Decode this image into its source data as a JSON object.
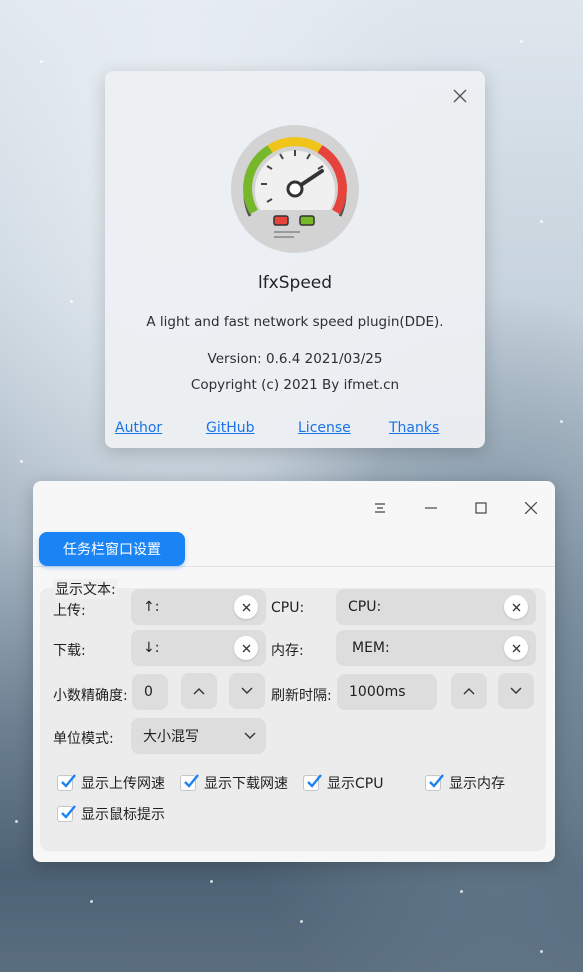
{
  "about": {
    "app_name": "lfxSpeed",
    "description": "A light and fast network speed plugin(DDE).",
    "version": "Version: 0.6.4  2021/03/25",
    "copyright": "Copyright (c) 2021 By ifmet.cn",
    "links": [
      "Author",
      "GitHub",
      "License",
      "Thanks"
    ]
  },
  "settings": {
    "tab": "任务栏窗口设置",
    "section_title": "显示文本:",
    "upload_label": "上传:",
    "upload_value": "↑:",
    "download_label": "下载:",
    "download_value": "↓:",
    "cpu_label": "CPU:",
    "cpu_value": "CPU:",
    "mem_label": "内存:",
    "mem_value": "MEM:",
    "precision_label": "小数精确度:",
    "precision_value": "0",
    "refresh_label": "刷新时隔:",
    "refresh_value": "1000ms",
    "unit_label": "单位模式:",
    "unit_value": "大小混写",
    "checkboxes": {
      "show_upload": "显示上传网速",
      "show_download": "显示下载网速",
      "show_cpu": "显示CPU",
      "show_mem": "显示内存",
      "show_tooltip": "显示鼠标提示"
    }
  },
  "colors": {
    "accent": "#1a84f5",
    "link": "#1a73e8"
  }
}
